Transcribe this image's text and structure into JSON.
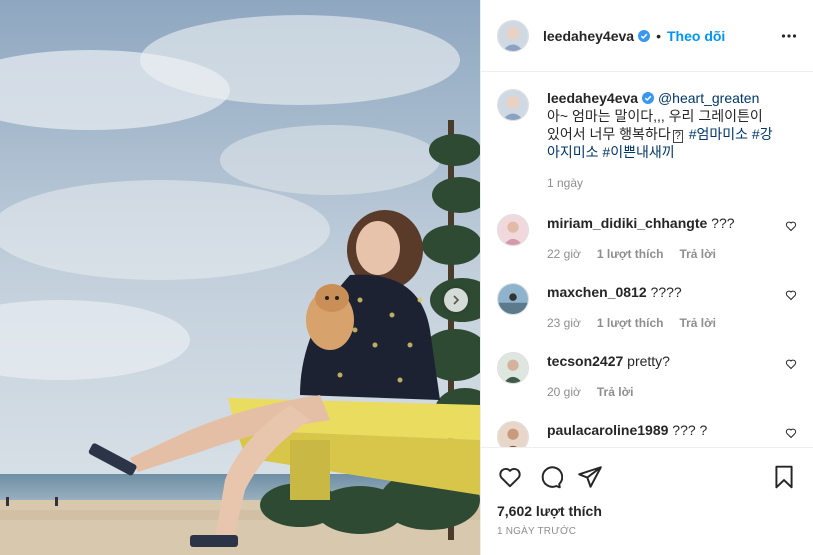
{
  "post": {
    "username": "leedahey4eva",
    "follow_label": "Theo dõi",
    "separator": "•"
  },
  "caption": {
    "username": "leedahey4eva",
    "mention": "@heart_greaten",
    "text": " 아~ 엄마는 말이다,,, 우리 그레이튼이 있어서 너무 행복하다",
    "emoji_glyph": "?",
    "tags": [
      "#엄마미소",
      "#강아지미소",
      "#이쁜내새끼"
    ],
    "time": "1 ngày"
  },
  "comments": [
    {
      "username": "miriam_didiki_chhangte",
      "text": "???",
      "time": "22 giờ",
      "likes": "1 lượt thích",
      "reply": "Trả lời"
    },
    {
      "username": "maxchen_0812",
      "text": "????",
      "time": "23 giờ",
      "likes": "1 lượt thích",
      "reply": "Trả lời"
    },
    {
      "username": "tecson2427",
      "text": "pretty?",
      "time": "20 giờ",
      "likes": "",
      "reply": "Trả lời"
    },
    {
      "username": "paulacaroline1989",
      "text": "??? ?",
      "time": "",
      "likes": "",
      "reply": ""
    }
  ],
  "footer": {
    "likes": "7,602 lượt thích",
    "date": "1 NGÀY TRƯỚC"
  },
  "colors": {
    "accent": "#0095f6",
    "tag": "#00376b",
    "muted": "#8e8e8e"
  },
  "icons": [
    "verified-badge-icon",
    "more-options-icon",
    "heart-icon",
    "comment-icon",
    "share-icon",
    "bookmark-icon",
    "chevron-right-icon"
  ]
}
